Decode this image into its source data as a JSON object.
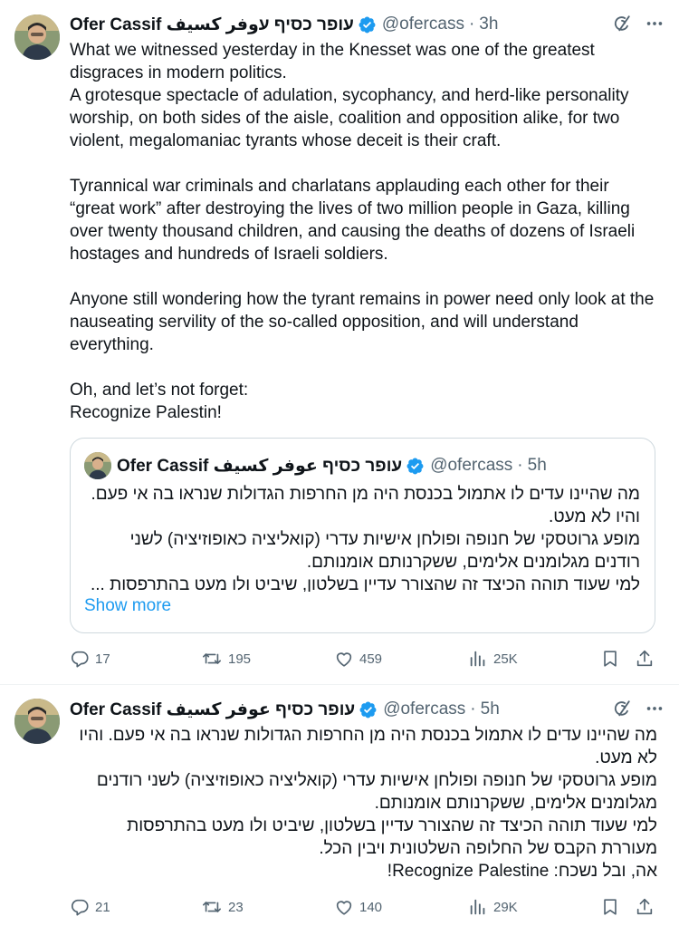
{
  "tweets": [
    {
      "author_name": "Ofer Cassif עופר כסיף עوفر كسيف",
      "handle": "@ofercass",
      "separator": "·",
      "time": "3h",
      "body": "What we witnessed yesterday in the Knesset was one of the greatest disgraces in modern politics.\nA grotesque spectacle of adulation, sycophancy, and herd-like personality worship, on both sides of the aisle, coalition and opposition alike, for two violent, megalomaniac tyrants whose deceit is their craft.\n\nTyrannical war criminals and charlatans applauding each other for their “great work” after destroying the lives of two million people in Gaza, killing over twenty thousand children, and causing the deaths of dozens of Israeli hostages and hundreds of Israeli soldiers.\n\nAnyone still wondering how the tyrant remains in power need only look at the nauseating servility of the so-called opposition, and will understand everything.\n\nOh, and let’s not forget:\nRecognize Palestin!",
      "quote": {
        "author_name": "Ofer Cassif עופר כסיף عوفر كسيف",
        "handle": "@ofercass",
        "separator": "·",
        "time": "5h",
        "body": "מה שהיינו עדים לו אתמול בכנסת היה מן החרפות הגדולות שנראו בה אי פעם. והיו לא מעט.\nמופע גרוטסקי של חנופה ופולחן אישיות עדרי (קואליציה כאופוזיציה) לשני רודנים מגלומנים אלימים, ששקרנותם אומנותם.\nלמי שעוד תוהה הכיצד זה שהצורר עדיין בשלטון, שיביט ולו מעט בהתרפסות ...",
        "show_more": "Show more"
      },
      "stats": {
        "replies": "17",
        "reposts": "195",
        "likes": "459",
        "views": "25K"
      }
    },
    {
      "author_name": "Ofer Cassif עופר כסיף عوفر كسيف",
      "handle": "@ofercass",
      "separator": "·",
      "time": "5h",
      "body": "מה שהיינו עדים לו אתמול בכנסת היה מן החרפות הגדולות שנראו בה אי פעם. והיו לא מעט.\nמופע גרוטסקי של חנופה ופולחן אישיות עדרי (קואליציה כאופוזיציה) לשני רודנים מגלומנים אלימים, ששקרנותם אומנותם.\nלמי שעוד תוהה הכיצד זה שהצורר עדיין בשלטון, שיביט ולו מעט בהתרפסות מעוררת הקבס של החלופה השלטונית ויבין הכל.\nאה, ובל נשכח: Recognize Palestine!",
      "stats": {
        "replies": "21",
        "reposts": "23",
        "likes": "140",
        "views": "29K"
      }
    }
  ],
  "icons": {
    "verified": "verified-badge-icon",
    "grok": "grok-icon",
    "more": "more-icon",
    "reply": "reply-icon",
    "repost": "repost-icon",
    "like": "heart-icon",
    "views": "views-icon",
    "bookmark": "bookmark-icon",
    "share": "share-icon"
  },
  "colors": {
    "text": "#0f1419",
    "secondary": "#536471",
    "accent": "#1d9bf0",
    "border": "#cfd9de"
  }
}
